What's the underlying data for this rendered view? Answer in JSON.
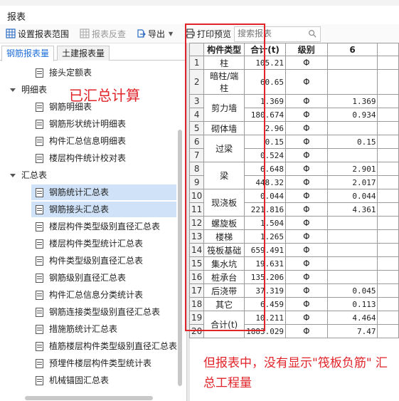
{
  "window": {
    "title": "报表"
  },
  "toolbar": {
    "settings_label": "设置报表范围",
    "reverse_label": "报表反查",
    "export_label": "导出",
    "print_label": "打印预览",
    "search_placeholder": "搜索报表"
  },
  "tabs": [
    "钢筋报表量",
    "土建报表量"
  ],
  "tree": {
    "items": [
      {
        "label": "接头定额表",
        "type": "leaf"
      },
      {
        "label": "明细表",
        "type": "group"
      },
      {
        "label": "钢筋明细表",
        "type": "leaf"
      },
      {
        "label": "钢筋形状统计明细表",
        "type": "leaf"
      },
      {
        "label": "构件汇总信息明细表",
        "type": "leaf"
      },
      {
        "label": "楼层构件统计校对表",
        "type": "leaf"
      },
      {
        "label": "汇总表",
        "type": "group"
      },
      {
        "label": "钢筋统计汇总表",
        "type": "leaf",
        "selected": true
      },
      {
        "label": "钢筋接头汇总表",
        "type": "leaf",
        "selected": true
      },
      {
        "label": "楼层构件类型级别直径汇总表",
        "type": "leaf"
      },
      {
        "label": "楼层构件类型统计汇总表",
        "type": "leaf"
      },
      {
        "label": "构件类型级别直径汇总表",
        "type": "leaf"
      },
      {
        "label": "钢筋级别直径汇总表",
        "type": "leaf"
      },
      {
        "label": "构件汇总信息分类统计表",
        "type": "leaf"
      },
      {
        "label": "钢筋连接类型级别直径汇总表",
        "type": "leaf"
      },
      {
        "label": "措施筋统计汇总表",
        "type": "leaf"
      },
      {
        "label": "植筋楼层构件类型级别直径汇总表",
        "type": "leaf"
      },
      {
        "label": "预埋件楼层构件类型统计表",
        "type": "leaf"
      },
      {
        "label": "机械锚固汇总表",
        "type": "leaf"
      }
    ]
  },
  "sheet": {
    "headers": [
      "构件类型",
      "合计(t)",
      "级别",
      "6"
    ],
    "rows": [
      {
        "n": "1",
        "type": "柱",
        "total": "105.21",
        "level": "Φ",
        "c6": ""
      },
      {
        "n": "2",
        "type": "暗柱/端柱",
        "total": "60.65",
        "level": "Φ",
        "c6": ""
      },
      {
        "n": "3",
        "type": "剪力墙",
        "total": "1.369",
        "level": "Φ",
        "c6": "1.369"
      },
      {
        "n": "4",
        "type": "",
        "total": "180.674",
        "level": "Φ",
        "c6": "0.934"
      },
      {
        "n": "5",
        "type": "砌体墙",
        "total": "2.96",
        "level": "Φ",
        "c6": ""
      },
      {
        "n": "6",
        "type": "过梁",
        "total": "0.15",
        "level": "Φ",
        "c6": "0.15"
      },
      {
        "n": "7",
        "type": "",
        "total": "0.524",
        "level": "Φ",
        "c6": ""
      },
      {
        "n": "8",
        "type": "梁",
        "total": "6.648",
        "level": "Φ",
        "c6": "2.901"
      },
      {
        "n": "9",
        "type": "",
        "total": "448.32",
        "level": "Φ",
        "c6": "2.017"
      },
      {
        "n": "10",
        "type": "现浇板",
        "total": "0.044",
        "level": "Φ",
        "c6": "0.044"
      },
      {
        "n": "11",
        "type": "",
        "total": "221.816",
        "level": "Φ",
        "c6": "4.361"
      },
      {
        "n": "12",
        "type": "螺旋板",
        "total": "1.504",
        "level": "Φ",
        "c6": ""
      },
      {
        "n": "13",
        "type": "楼梯",
        "total": "1.265",
        "level": "Φ",
        "c6": ""
      },
      {
        "n": "14",
        "type": "筏板基础",
        "total": "659.491",
        "level": "Φ",
        "c6": ""
      },
      {
        "n": "15",
        "type": "集水坑",
        "total": "19.631",
        "level": "Φ",
        "c6": ""
      },
      {
        "n": "16",
        "type": "桩承台",
        "total": "135.206",
        "level": "Φ",
        "c6": ""
      },
      {
        "n": "17",
        "type": "后浇带",
        "total": "37.319",
        "level": "Φ",
        "c6": "0.045"
      },
      {
        "n": "18",
        "type": "其它",
        "total": "6.459",
        "level": "Φ",
        "c6": "0.113"
      },
      {
        "n": "19",
        "type": "合计(t)",
        "total": "10.211",
        "level": "Φ",
        "c6": "4.464"
      },
      {
        "n": "20",
        "type": "",
        "total": "1883.029",
        "level": "Φ",
        "c6": "7.47"
      }
    ]
  },
  "annotations": {
    "note1": "已汇总计算",
    "note2": "但报表中，没有显示\"筏板负筋\" 汇总工程量"
  },
  "colors": {
    "annotation": "#e0242a",
    "selected": "#cfe2f7",
    "tab_active": "#1e6fd9"
  }
}
